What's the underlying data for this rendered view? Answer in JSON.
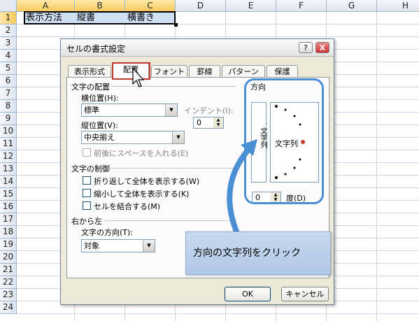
{
  "spreadsheet": {
    "columns": [
      "A",
      "B",
      "C",
      "D",
      "E",
      "F",
      "G",
      "H"
    ],
    "rows": [
      "1",
      "2",
      "3",
      "4",
      "5",
      "6",
      "7",
      "8",
      "9",
      "10",
      "11",
      "12",
      "13",
      "14",
      "15",
      "16",
      "17",
      "18",
      "19",
      "20",
      "21",
      "22",
      "23",
      "24"
    ],
    "cells": {
      "A1": "表示方法",
      "B1": "縦書",
      "C1": "横書き"
    }
  },
  "dialog": {
    "title": "セルの書式設定",
    "help_label": "?",
    "close_label": "X",
    "tabs": [
      "表示形式",
      "配置",
      "フォント",
      "罫線",
      "パターン",
      "保護"
    ],
    "text_alignment": {
      "heading": "文字の配置",
      "horizontal_label": "横位置(H):",
      "horizontal_value": "標準",
      "vertical_label": "縦位置(V):",
      "vertical_value": "中央揃え",
      "indent_label": "インデント(I):",
      "indent_value": "0",
      "justify_distributed_label": "前後にスペースを入れる(E)"
    },
    "text_control": {
      "heading": "文字の制御",
      "wrap_label": "折り返して全体を表示する(W)",
      "shrink_label": "縮小して全体を表示する(K)",
      "merge_label": "セルを結合する(M)"
    },
    "rtl": {
      "heading": "右から左",
      "direction_label": "文字の方向(T):",
      "direction_value": "対象"
    },
    "orientation": {
      "heading": "方向",
      "vertical_text": "文字列",
      "dial_text": "文字列",
      "degrees_value": "0",
      "degrees_label": "度(D)"
    },
    "ok_label": "OK",
    "cancel_label": "キャンセル"
  },
  "callout": {
    "text": "方向の文字列をクリック"
  },
  "colors": {
    "highlight": "#4a8ed4",
    "callout_bg": "#b0c8e6",
    "tab_box": "#c0392b",
    "dial_marker": "#c0392b"
  }
}
